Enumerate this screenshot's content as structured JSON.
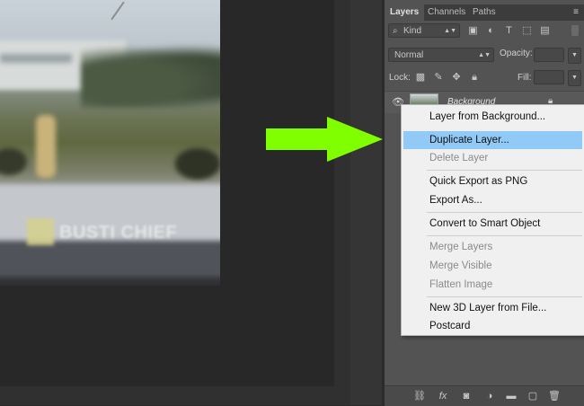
{
  "panel": {
    "tabs": [
      "Layers",
      "Channels",
      "Paths"
    ],
    "menu_icon": "≡",
    "filter": {
      "kind_label": "Kind"
    },
    "blend_mode": "Normal",
    "opacity_label": "Opacity:",
    "lock_label": "Lock:",
    "fill_label": "Fill:",
    "layer": {
      "name": "Background"
    }
  },
  "canvas": {
    "watermark_text": "BUSTI CHIEF"
  },
  "context_menu": {
    "items": [
      "Layer from Background...",
      "Duplicate Layer...",
      "Delete Layer",
      "Quick Export as PNG",
      "Export As...",
      "Convert to Smart Object",
      "Merge Layers",
      "Merge Visible",
      "Flatten Image",
      "New 3D Layer from File...",
      "Postcard"
    ],
    "highlighted": "Duplicate Layer...",
    "disabled": [
      "Delete Layer",
      "Merge Layers",
      "Merge Visible",
      "Flatten Image"
    ]
  },
  "colors": {
    "arrow": "#7fff00",
    "menu_highlight": "#91c9f7",
    "panel_bg": "#535353"
  }
}
